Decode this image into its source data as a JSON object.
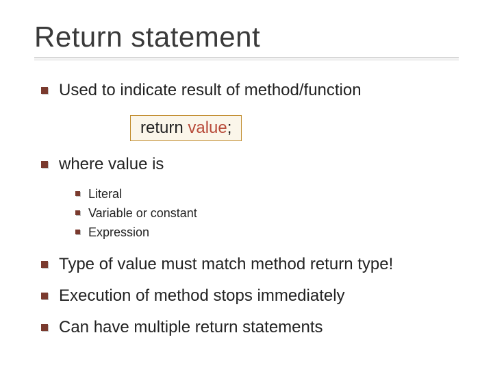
{
  "title": "Return statement",
  "bullets": {
    "b1": "Used to indicate result of method/function",
    "code_kw": "return ",
    "code_val": "value",
    "code_tail": ";",
    "b2": "where value is",
    "sub1": "Literal",
    "sub2": "Variable or constant",
    "sub3": "Expression",
    "b3": "Type of value must match method return type!",
    "b4": "Execution of method stops immediately",
    "b5": "Can have multiple return statements"
  }
}
